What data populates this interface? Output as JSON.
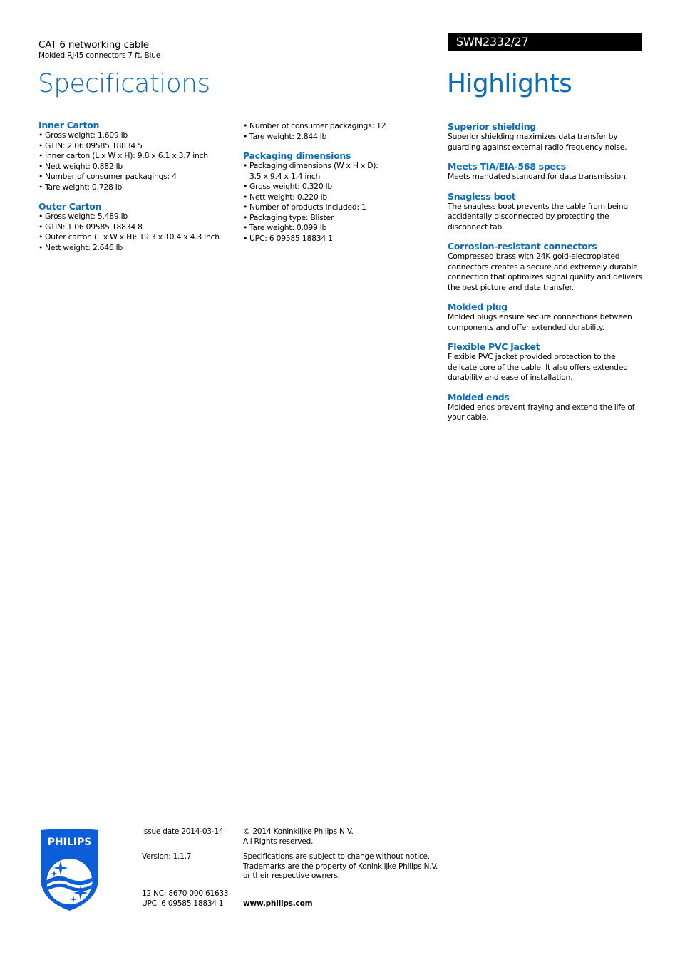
{
  "header": {
    "product_title": "CAT 6 networking cable",
    "product_subtitle": "Molded RJ45 connectors 7 ft, Blue",
    "spec_heading": "Specifications",
    "model_number": "SWN2332/27",
    "highlights_heading": "Highlights"
  },
  "colors": {
    "accent": "#0e6cb8",
    "badge_bg": "#000000",
    "logo_blue": "#0b5ed7"
  },
  "specifications": {
    "inner_carton": {
      "title": "Inner Carton",
      "items": [
        "Gross weight: 1.609 lb",
        "GTIN: 2 06 09585 18834 5",
        "Inner carton (L x W x H): 9.8 x 6.1 x 3.7 inch",
        "Nett weight: 0.882 lb",
        "Number of consumer packagings: 4",
        "Tare weight: 0.728 lb"
      ]
    },
    "outer_carton": {
      "title": "Outer Carton",
      "items": [
        "Gross weight: 5.489 lb",
        "GTIN: 1 06 09585 18834 8",
        "Outer carton (L x W x H): 19.3 x 10.4 x 4.3 inch",
        "Nett weight: 2.646 lb",
        "Number of consumer packagings: 12",
        "Tare weight: 2.844 lb"
      ]
    },
    "packaging_dimensions": {
      "title": "Packaging dimensions",
      "items": [
        "Packaging dimensions (W x H x D): 3.5 x 9.4 x 1.4 inch",
        "Gross weight: 0.320 lb",
        "Nett weight: 0.220 lb",
        "Number of products included: 1",
        "Packaging type: Blister",
        "Tare weight: 0.099 lb",
        "UPC: 6 09585 18834 1"
      ]
    }
  },
  "highlights": [
    {
      "title": "Superior shielding",
      "body": "Superior shielding maximizes data transfer by guarding against external radio frequency noise."
    },
    {
      "title": "Meets TIA/EIA-568 specs",
      "body": "Meets mandated standard for data transmission."
    },
    {
      "title": "Snagless boot",
      "body": "The snagless boot prevents the cable from being accidentally disconnected by protecting the disconnect tab."
    },
    {
      "title": "Corrosion-resistant connectors",
      "body": "Compressed brass with 24K gold-electroplated connectors creates a secure and extremely durable connection that optimizes signal quality and delivers the best picture and data transfer."
    },
    {
      "title": "Molded plug",
      "body": "Molded plugs ensure secure connections between components and offer extended durability."
    },
    {
      "title": "Flexible PVC Jacket",
      "body": "Flexible PVC jacket provided protection to the delicate core of the cable. It also offers extended durability and ease of installation."
    },
    {
      "title": "Molded ends",
      "body": "Molded ends prevent fraying and extend the life of your cable."
    }
  ],
  "footer": {
    "logo_text": "PHILIPS",
    "issue_date": "Issue date 2014-03-14",
    "version": "Version: 1.1.7",
    "nc": "12 NC: 8670 000 61633",
    "upc": "UPC: 6 09585 18834 1",
    "copyright_line1": "© 2014 Koninklijke Philips N.V.",
    "copyright_line2": "All Rights reserved.",
    "disclaimer_line1": "Specifications are subject to change without notice.",
    "disclaimer_line2": "Trademarks are the property of Koninklijke Philips N.V.",
    "disclaimer_line3": "or their respective owners.",
    "website": "www.philips.com"
  }
}
